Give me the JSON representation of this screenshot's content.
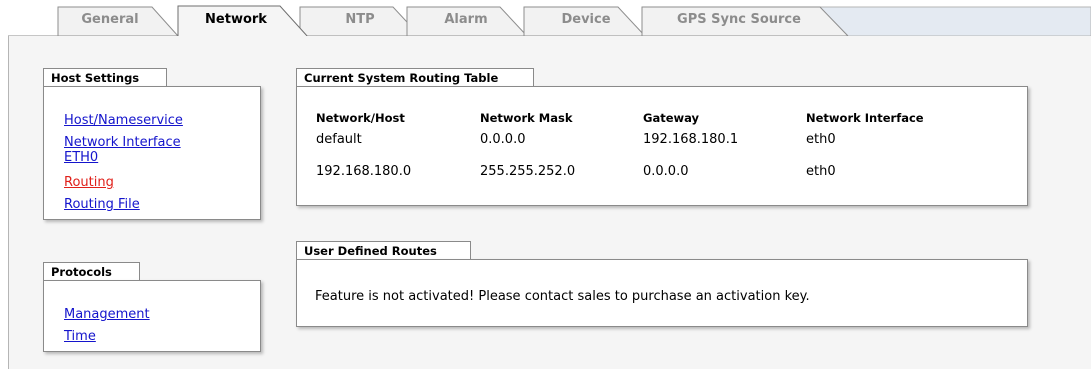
{
  "tabs": [
    {
      "label": "General",
      "active": false
    },
    {
      "label": "Network",
      "active": true
    },
    {
      "label": "NTP",
      "active": false
    },
    {
      "label": "Alarm",
      "active": false
    },
    {
      "label": "Device",
      "active": false
    },
    {
      "label": "GPS Sync Source",
      "active": false
    }
  ],
  "host_settings": {
    "title": "Host Settings",
    "links": [
      {
        "label": "Host/Nameservice"
      },
      {
        "label": "Network Interface"
      },
      {
        "label": "ETH0"
      },
      {
        "label": "Routing",
        "current": true
      },
      {
        "label": "Routing File"
      }
    ]
  },
  "protocols": {
    "title": "Protocols",
    "links": [
      {
        "label": "Management"
      },
      {
        "label": "Time"
      }
    ]
  },
  "routing_table": {
    "title": "Current System Routing Table",
    "headers": [
      "Network/Host",
      "Network Mask",
      "Gateway",
      "Network Interface"
    ],
    "rows": [
      [
        "default",
        "0.0.0.0",
        "192.168.180.1",
        "eth0"
      ],
      [
        "192.168.180.0",
        "255.255.252.0",
        "0.0.0.0",
        "eth0"
      ]
    ]
  },
  "user_routes": {
    "title": "User Defined Routes",
    "message": "Feature is not activated! Please contact sales to purchase an activation key."
  },
  "colors": {
    "link": "#1414cc",
    "current_link": "#e0201a",
    "content_bg": "#f5f5f5",
    "inactive_tab_bg": "#f2f2f2",
    "tab_strip_bg": "#e4eaf2"
  }
}
